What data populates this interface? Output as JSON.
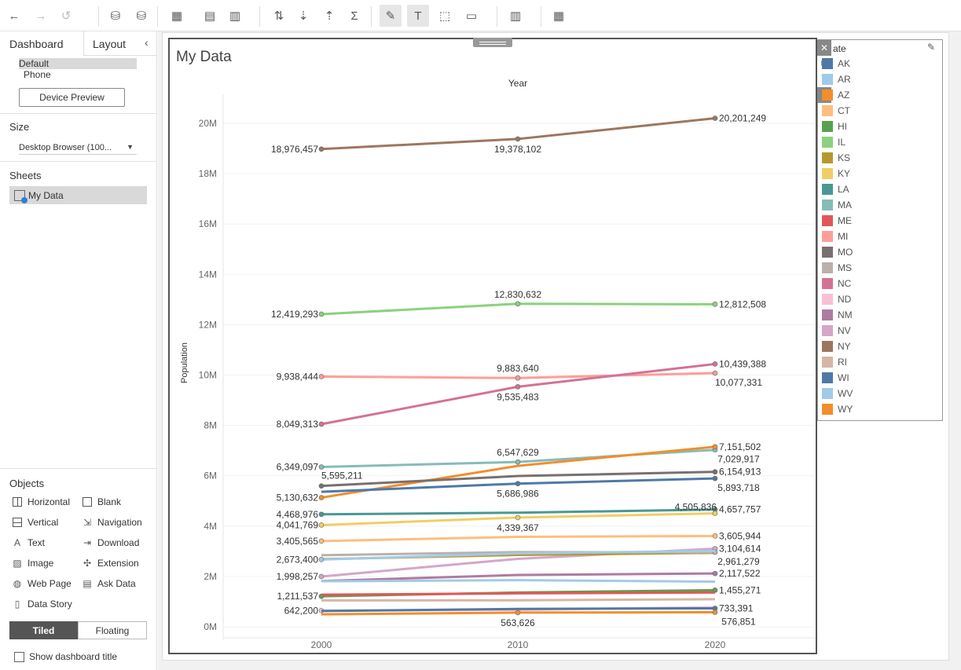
{
  "toolbar": {
    "buttons": [
      {
        "name": "undo-button",
        "icon": "←"
      },
      {
        "name": "redo-button",
        "icon": "→"
      },
      {
        "name": "replay-button",
        "icon": "↺"
      },
      {
        "name": "new-datasource-button",
        "icon": "⛁"
      },
      {
        "name": "pause-updates-button",
        "icon": "⛁"
      },
      {
        "name": "new-worksheet-button",
        "icon": "▦"
      },
      {
        "name": "duplicate-sheet-button",
        "icon": "▤"
      },
      {
        "name": "clear-sheet-button",
        "icon": "▥"
      },
      {
        "name": "swap-rows-columns-button",
        "icon": "⇅"
      },
      {
        "name": "sort-ascending-button",
        "icon": "⇣"
      },
      {
        "name": "sort-descending-button",
        "icon": "⇡"
      },
      {
        "name": "totals-button",
        "icon": "Σ"
      },
      {
        "name": "highlight-button",
        "icon": "✎"
      },
      {
        "name": "labels-button",
        "icon": "T"
      },
      {
        "name": "fix-axes-button",
        "icon": "⬚"
      },
      {
        "name": "fit-button",
        "icon": "▭"
      },
      {
        "name": "show-cards-button",
        "icon": "▥"
      },
      {
        "name": "show-me-button",
        "icon": "▦"
      },
      {
        "name": "download-button",
        "icon": "⤓"
      }
    ]
  },
  "left_panel": {
    "tabs": [
      "Dashboard",
      "Layout"
    ],
    "device_options": [
      "Default",
      "Phone"
    ],
    "device_preview_label": "Device Preview",
    "size_title": "Size",
    "size_value": "Desktop Browser (100...",
    "sheets_title": "Sheets",
    "sheet_name": "My Data",
    "objects_title": "Objects",
    "objects": [
      "Horizontal",
      "Blank",
      "Vertical",
      "Navigation",
      "Text",
      "Download",
      "Image",
      "Extension",
      "Web Page",
      "Ask Data",
      "Data Story"
    ],
    "layout_mode": [
      "Tiled",
      "Floating"
    ],
    "show_title_label": "Show dashboard title"
  },
  "viz": {
    "title": "My Data",
    "column_header": "Year"
  },
  "legend": {
    "title": "ate",
    "items": [
      {
        "label": "AK",
        "color": "#4e79a7"
      },
      {
        "label": "AR",
        "color": "#a0cbe8"
      },
      {
        "label": "AZ",
        "color": "#f28e2b"
      },
      {
        "label": "CT",
        "color": "#ffbe7d"
      },
      {
        "label": "HI",
        "color": "#59a14f"
      },
      {
        "label": "IL",
        "color": "#8cd17d"
      },
      {
        "label": "KS",
        "color": "#b6992d"
      },
      {
        "label": "KY",
        "color": "#f1ce63"
      },
      {
        "label": "LA",
        "color": "#499894"
      },
      {
        "label": "MA",
        "color": "#86bcb6"
      },
      {
        "label": "ME",
        "color": "#e15759"
      },
      {
        "label": "MI",
        "color": "#ff9d9a"
      },
      {
        "label": "MO",
        "color": "#79706e"
      },
      {
        "label": "MS",
        "color": "#bab0ac"
      },
      {
        "label": "NC",
        "color": "#d37295"
      },
      {
        "label": "ND",
        "color": "#fabfd2"
      },
      {
        "label": "NM",
        "color": "#b07aa1"
      },
      {
        "label": "NV",
        "color": "#d4a6c8"
      },
      {
        "label": "NY",
        "color": "#9d7660"
      },
      {
        "label": "RI",
        "color": "#d7b5a6"
      },
      {
        "label": "WI",
        "color": "#4e79a7"
      },
      {
        "label": "WV",
        "color": "#a0cbe8"
      },
      {
        "label": "WY",
        "color": "#f28e2b"
      }
    ]
  },
  "chart_data": {
    "type": "line",
    "title": "My Data",
    "xlabel": "Year",
    "ylabel": "Population",
    "x": [
      "2000",
      "2010",
      "2020"
    ],
    "ylim": [
      0,
      21000000
    ],
    "yticks": [
      "0M",
      "2M",
      "4M",
      "6M",
      "8M",
      "10M",
      "12M",
      "14M",
      "16M",
      "18M",
      "20M"
    ],
    "legend_position": "right",
    "series": [
      {
        "name": "NY",
        "color": "#9d7660",
        "values": [
          18976457,
          19378102,
          20201249
        ],
        "labels": [
          "18,976,457",
          "19,378,102",
          "20,201,249"
        ]
      },
      {
        "name": "IL",
        "color": "#8cd17d",
        "values": [
          12419293,
          12830632,
          12812508
        ],
        "labels": [
          "12,419,293",
          "12,830,632",
          "12,812,508"
        ]
      },
      {
        "name": "MI",
        "color": "#ff9d9a",
        "values": [
          9938444,
          9883640,
          10077331
        ],
        "labels": [
          "9,938,444",
          "9,883,640",
          "10,077,331"
        ]
      },
      {
        "name": "NC",
        "color": "#d37295",
        "values": [
          8049313,
          9535483,
          10439388
        ],
        "labels": [
          "8,049,313",
          "9,535,483",
          "10,439,388"
        ]
      },
      {
        "name": "MA",
        "color": "#86bcb6",
        "values": [
          6349097,
          6547629,
          7029917
        ],
        "labels": [
          "6,349,097",
          "6,547,629",
          "7,029,917"
        ]
      },
      {
        "name": "AZ",
        "color": "#f28e2b",
        "values": [
          5130632,
          6392017,
          7151502
        ],
        "labels": [
          "5,130,632",
          "",
          "7,151,502"
        ]
      },
      {
        "name": "MO",
        "color": "#79706e",
        "values": [
          5595211,
          5988927,
          6154913
        ],
        "labels": [
          "5,595,211",
          "",
          "6,154,913"
        ]
      },
      {
        "name": "WI",
        "color": "#4e79a7",
        "values": [
          5363675,
          5686986,
          5893718
        ],
        "labels": [
          "",
          "5,686,986",
          "5,893,718"
        ]
      },
      {
        "name": "LA",
        "color": "#499894",
        "values": [
          4468976,
          4533372,
          4657757
        ],
        "labels": [
          "4,468,976",
          "",
          "4,657,757"
        ]
      },
      {
        "name": "KY",
        "color": "#f1ce63",
        "values": [
          4041769,
          4339367,
          4505836
        ],
        "labels": [
          "4,041,769",
          "4,339,367",
          "4,505,836"
        ]
      },
      {
        "name": "CT",
        "color": "#ffbe7d",
        "values": [
          3405565,
          3574097,
          3605944
        ],
        "labels": [
          "3,405,565",
          "",
          "3,605,944"
        ]
      },
      {
        "name": "NV",
        "color": "#d4a6c8",
        "values": [
          1998257,
          2700551,
          3104614
        ],
        "labels": [
          "1,998,257",
          "",
          "3,104,614"
        ]
      },
      {
        "name": "KS",
        "color": "#b6992d",
        "values": [
          2688418,
          2853118,
          2937880
        ],
        "labels": [
          "",
          "",
          ""
        ]
      },
      {
        "name": "MS",
        "color": "#bab0ac",
        "values": [
          2844658,
          2967297,
          2961279
        ],
        "labels": [
          "",
          "",
          "2,961,279"
        ]
      },
      {
        "name": "AR",
        "color": "#a0cbe8",
        "values": [
          2673400,
          2915918,
          3011524
        ],
        "labels": [
          "2,673,400",
          "",
          ""
        ]
      },
      {
        "name": "NM",
        "color": "#b07aa1",
        "values": [
          1819046,
          2059179,
          2117522
        ],
        "labels": [
          "",
          "",
          "2,117,522"
        ]
      },
      {
        "name": "WV",
        "color": "#a0cbe8",
        "values": [
          1808344,
          1852994,
          1793716
        ],
        "labels": [
          "",
          "",
          ""
        ]
      },
      {
        "name": "HI",
        "color": "#59a14f",
        "values": [
          1211537,
          1360301,
          1455271
        ],
        "labels": [
          "1,211,537",
          "",
          "1,455,271"
        ]
      },
      {
        "name": "ME",
        "color": "#e15759",
        "values": [
          1274923,
          1328361,
          1362359
        ],
        "labels": [
          "",
          "",
          ""
        ]
      },
      {
        "name": "RI",
        "color": "#d7b5a6",
        "values": [
          1048319,
          1052567,
          1097379
        ],
        "labels": [
          "",
          "",
          ""
        ]
      },
      {
        "name": "ND",
        "color": "#fabfd2",
        "values": [
          642200,
          672591,
          779094
        ],
        "labels": [
          "642,200",
          "",
          ""
        ]
      },
      {
        "name": "AK",
        "color": "#4e79a7",
        "values": [
          626932,
          710231,
          733391
        ],
        "labels": [
          "",
          "",
          "733,391"
        ]
      },
      {
        "name": "WY",
        "color": "#f28e2b",
        "values": [
          493782,
          563626,
          576851
        ],
        "labels": [
          "",
          "563,626",
          "576,851"
        ]
      }
    ]
  }
}
